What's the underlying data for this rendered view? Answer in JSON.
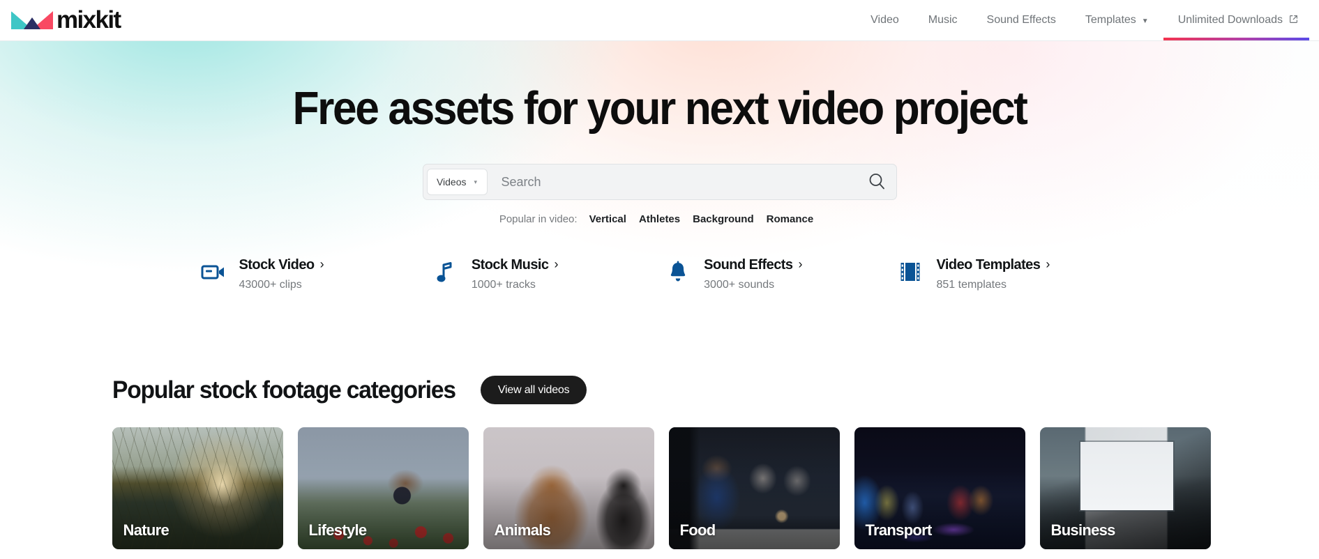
{
  "header": {
    "logo": {
      "text": "mixkit",
      "icon": "mixkit-logo-icon"
    },
    "nav": [
      {
        "label": "Video",
        "caret": "",
        "external": false
      },
      {
        "label": "Music",
        "caret": "",
        "external": false
      },
      {
        "label": "Sound Effects",
        "caret": "",
        "external": false
      },
      {
        "label": "Templates",
        "caret": "▼",
        "external": false
      },
      {
        "label": "Unlimited Downloads",
        "caret": "",
        "external": true
      }
    ],
    "active_underline_gradient": {
      "from": "#f4334f",
      "to": "#5a4ae8"
    }
  },
  "hero": {
    "title": "Free assets for your next video project",
    "search": {
      "type_label": "Videos",
      "type_caret": "▾",
      "placeholder": "Search",
      "value": "",
      "search_icon": "search-icon"
    },
    "popular": {
      "label": "Popular in video:",
      "tags": [
        "Vertical",
        "Athletes",
        "Background",
        "Romance"
      ]
    }
  },
  "shortcuts": [
    {
      "icon": "video-camera-icon",
      "title": "Stock Video",
      "chevron": "›",
      "subtitle": "43000+ clips"
    },
    {
      "icon": "music-note-icon",
      "title": "Stock Music",
      "chevron": "›",
      "subtitle": "1000+ tracks"
    },
    {
      "icon": "bell-icon",
      "title": "Sound Effects",
      "chevron": "›",
      "subtitle": "3000+ sounds"
    },
    {
      "icon": "film-strip-icon",
      "title": "Video Templates",
      "chevron": "›",
      "subtitle": "851 templates"
    }
  ],
  "categories_section": {
    "title": "Popular stock footage categories",
    "view_all_label": "View all videos",
    "cards": [
      {
        "label": "Nature"
      },
      {
        "label": "Lifestyle"
      },
      {
        "label": "Animals"
      },
      {
        "label": "Food"
      },
      {
        "label": "Transport"
      },
      {
        "label": "Business"
      }
    ]
  },
  "colors": {
    "accent_blue": "#0a5395",
    "logo_teal": "#3ec6c6",
    "logo_pink": "#f94963",
    "logo_navy": "#2b2e63",
    "button_dark": "#1c1c1c"
  }
}
